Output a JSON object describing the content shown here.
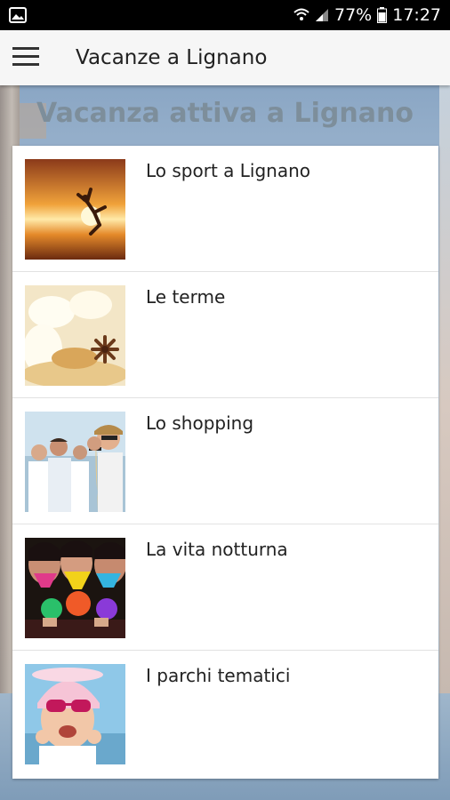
{
  "status_bar": {
    "battery": "77%",
    "time": "17:27"
  },
  "app_bar": {
    "title": "Vacanze a Lignano",
    "menu_icon": "hamburger-menu-icon"
  },
  "section": {
    "title": "Vacanza attiva a Lignano"
  },
  "items": [
    {
      "label": "Lo sport a Lignano",
      "thumb": "sport-thumbnail"
    },
    {
      "label": "Le terme",
      "thumb": "spa-thumbnail"
    },
    {
      "label": "Lo shopping",
      "thumb": "shopping-thumbnail"
    },
    {
      "label": "La vita notturna",
      "thumb": "nightlife-thumbnail"
    },
    {
      "label": "I parchi tematici",
      "thumb": "theme-parks-thumbnail"
    }
  ]
}
